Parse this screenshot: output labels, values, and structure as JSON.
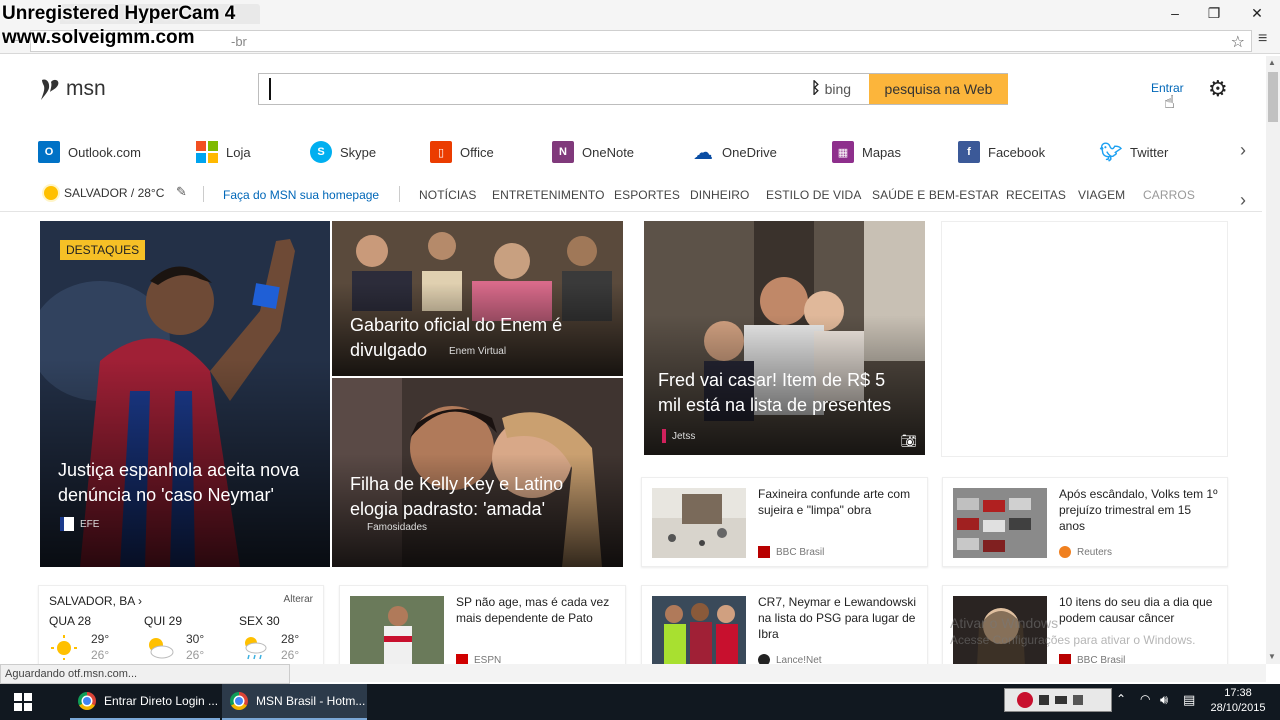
{
  "watermark": {
    "line1": "Unregistered HyperCam 4",
    "line2": "www.solveigmm.com"
  },
  "browser": {
    "address_text": "-br",
    "window_controls": {
      "minimize": "–",
      "maximize": "❐",
      "close": "✕"
    }
  },
  "header": {
    "logo_text": "msn",
    "search": {
      "value": "",
      "bing_label": "bing",
      "button_label": "pesquisa na Web"
    },
    "signin_label": "Entrar"
  },
  "apps": [
    {
      "label": "Outlook.com",
      "icon": "outlook-icon",
      "color": "#0072c6"
    },
    {
      "label": "Loja",
      "icon": "store-icon",
      "color": "#f25022"
    },
    {
      "label": "Skype",
      "icon": "skype-icon",
      "color": "#00aff0"
    },
    {
      "label": "Office",
      "icon": "office-icon",
      "color": "#eb3c00"
    },
    {
      "label": "OneNote",
      "icon": "onenote-icon",
      "color": "#80397b"
    },
    {
      "label": "OneDrive",
      "icon": "onedrive-icon",
      "color": "#0a4da3"
    },
    {
      "label": "Mapas",
      "icon": "maps-icon",
      "color": "#8e2f8c"
    },
    {
      "label": "Facebook",
      "icon": "facebook-icon",
      "color": "#3b5998"
    },
    {
      "label": "Twitter",
      "icon": "twitter-icon",
      "color": "#1da1f2"
    }
  ],
  "nav": {
    "weather": "SALVADOR / 28°C",
    "homepage_link": "Faça do MSN sua homepage",
    "items": [
      "NOTÍCIAS",
      "ENTRETENIMENTO",
      "ESPORTES",
      "DINHEIRO",
      "ESTILO DE VIDA",
      "SAÚDE E BEM-ESTAR",
      "RECEITAS",
      "VIAGEM",
      "CARROS"
    ]
  },
  "hero": {
    "badge": "DESTAQUES",
    "main": {
      "title": "Justiça espanhola aceita nova denúncia no 'caso Neymar'",
      "source": "EFE"
    },
    "top_right": {
      "title": "Gabarito oficial do Enem é divulgado",
      "source": "Enem Virtual"
    },
    "bottom_right": {
      "title": "Filha de Kelly Key e Latino elogia padrasto: 'amada'",
      "source": "Famosidades"
    },
    "feature": {
      "title": "Fred vai casar! Item de R$ 5 mil está na lista de presentes",
      "source": "Jetss"
    }
  },
  "cards": [
    {
      "title": "Faxineira confunde arte com sujeira e \"limpa\" obra",
      "source": "BBC Brasil"
    },
    {
      "title": "Após escândalo, Volks tem 1º prejuízo trimestral em 15 anos",
      "source": "Reuters"
    },
    {
      "title": "SP não age, mas é cada vez mais dependente de Pato",
      "source": "ESPN"
    },
    {
      "title": "CR7, Neymar e Lewandowski na lista do PSG para lugar de Ibra",
      "source": "Lance!Net"
    },
    {
      "title": "10 itens do seu dia a dia que podem causar câncer",
      "source": "BBC Brasil"
    }
  ],
  "weather_card": {
    "location": "SALVADOR, BA",
    "change_label": "Alterar",
    "days": [
      {
        "name": "QUA 28",
        "hi": "29°",
        "lo": "26°",
        "icon": "sun-icon"
      },
      {
        "name": "QUI 29",
        "hi": "30°",
        "lo": "26°",
        "icon": "partly-cloudy-icon"
      },
      {
        "name": "SEX 30",
        "hi": "28°",
        "lo": "26°",
        "icon": "rain-sun-icon"
      }
    ]
  },
  "activation": {
    "line1": "Ativar o Windows",
    "line2": "Acesse Configurações para ativar o Windows."
  },
  "status_text": "Aguardando otf.msn.com...",
  "taskbar": {
    "items": [
      {
        "label": "Entrar Direto Login ..."
      },
      {
        "label": "MSN Brasil - Hotm..."
      }
    ],
    "time": "17:38",
    "date": "28/10/2015"
  }
}
